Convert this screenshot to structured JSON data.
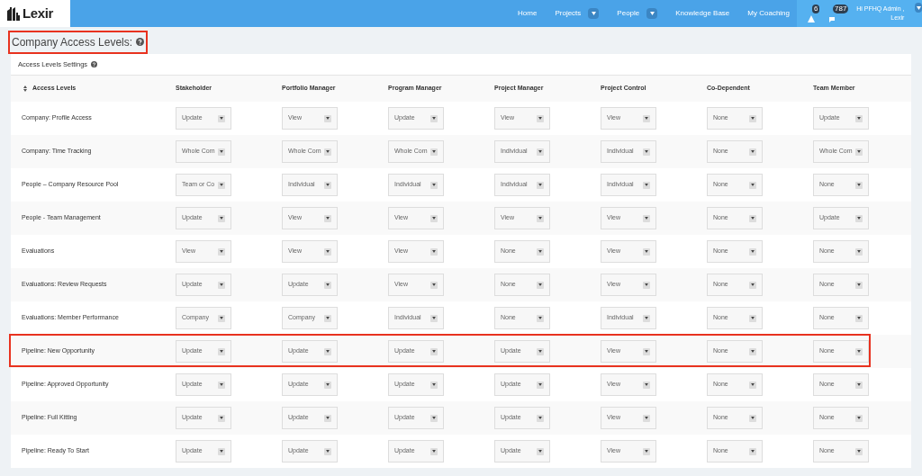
{
  "brand": {
    "name": "Lexir"
  },
  "nav": [
    {
      "label": "Home",
      "dropdown": false
    },
    {
      "label": "Projects",
      "dropdown": true
    },
    {
      "label": "People",
      "dropdown": true
    },
    {
      "label": "Knowledge Base",
      "dropdown": false
    },
    {
      "label": "My Coaching",
      "dropdown": false
    }
  ],
  "notifications": [
    {
      "kind": "alert",
      "count": "6"
    },
    {
      "kind": "messages",
      "count": "787"
    }
  ],
  "user": {
    "greeting": "Hi PFHQ Admin ,",
    "company": "Lexir"
  },
  "heading": {
    "title": "Company Access Levels:",
    "highlighted": true
  },
  "card": {
    "title": "Access Levels Settings"
  },
  "table": {
    "columns": [
      "Access Levels",
      "Stakeholder",
      "Portfolio Manager",
      "Program Manager",
      "Project Manager",
      "Project Control",
      "Co-Dependent",
      "Team Member"
    ],
    "rows": [
      {
        "name": "Company: Profile Access",
        "highlighted": false,
        "values": [
          "Update",
          "View",
          "Update",
          "View",
          "View",
          "None",
          "Update"
        ]
      },
      {
        "name": "Company: Time Tracking",
        "highlighted": false,
        "values": [
          "Whole Com",
          "Whole Com",
          "Whole Com",
          "Individual",
          "Individual",
          "None",
          "Whole Com"
        ]
      },
      {
        "name": "People – Company Resource Pool",
        "highlighted": false,
        "values": [
          "Team or Co",
          "Individual",
          "Individual",
          "Individual",
          "Individual",
          "None",
          "None"
        ]
      },
      {
        "name": "People - Team Management",
        "highlighted": false,
        "values": [
          "Update",
          "View",
          "View",
          "View",
          "View",
          "None",
          "Update"
        ]
      },
      {
        "name": "Evaluations",
        "highlighted": false,
        "values": [
          "View",
          "View",
          "View",
          "None",
          "View",
          "None",
          "None"
        ]
      },
      {
        "name": "Evaluations: Review Requests",
        "highlighted": false,
        "values": [
          "Update",
          "Update",
          "View",
          "None",
          "View",
          "None",
          "None"
        ]
      },
      {
        "name": "Evaluations: Member Performance",
        "highlighted": false,
        "values": [
          "Company",
          "Company",
          "Individual",
          "None",
          "Individual",
          "None",
          "None"
        ]
      },
      {
        "name": "Pipeline: New Opportunity",
        "highlighted": true,
        "values": [
          "Update",
          "Update",
          "Update",
          "Update",
          "View",
          "None",
          "None"
        ]
      },
      {
        "name": "Pipeline: Approved Opportunity",
        "highlighted": false,
        "values": [
          "Update",
          "Update",
          "Update",
          "Update",
          "View",
          "None",
          "None"
        ]
      },
      {
        "name": "Pipeline: Full Kitting",
        "highlighted": false,
        "values": [
          "Update",
          "Update",
          "Update",
          "Update",
          "View",
          "None",
          "None"
        ]
      },
      {
        "name": "Pipeline: Ready To Start",
        "highlighted": false,
        "values": [
          "Update",
          "Update",
          "Update",
          "Update",
          "View",
          "None",
          "None"
        ]
      }
    ]
  }
}
